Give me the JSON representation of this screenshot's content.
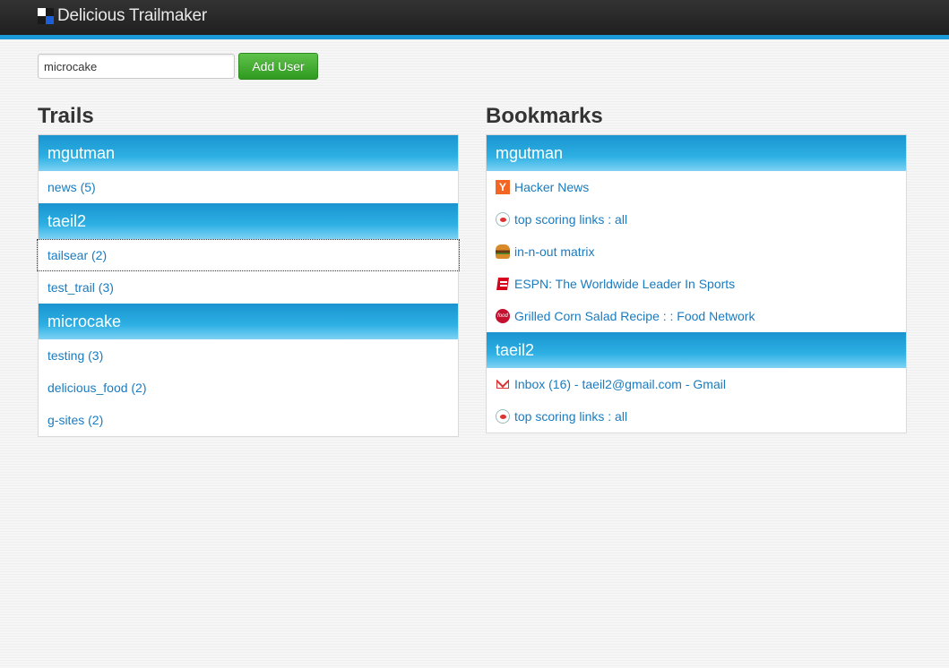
{
  "app": {
    "title": "Delicious Trailmaker"
  },
  "search": {
    "value": "microcake",
    "button_label": "Add User"
  },
  "trails": {
    "title": "Trails",
    "groups": [
      {
        "user": "mgutman",
        "items": [
          "news (5)"
        ]
      },
      {
        "user": "taeil2",
        "items": [
          "tailsear (2)",
          "test_trail (3)"
        ]
      },
      {
        "user": "microcake",
        "items": [
          "testing (3)",
          "delicious_food (2)",
          "g-sites (2)"
        ]
      }
    ]
  },
  "bookmarks": {
    "title": "Bookmarks",
    "groups": [
      {
        "user": "mgutman",
        "items": [
          {
            "label": "Hacker News",
            "icon": "hacker-news-icon"
          },
          {
            "label": "top scoring links : all",
            "icon": "reddit-icon"
          },
          {
            "label": "in-n-out matrix",
            "icon": "burger-icon"
          },
          {
            "label": "ESPN: The Worldwide Leader In Sports",
            "icon": "espn-icon"
          },
          {
            "label": "Grilled Corn Salad Recipe : : Food Network",
            "icon": "food-network-icon"
          }
        ]
      },
      {
        "user": "taeil2",
        "items": [
          {
            "label": "Inbox (16) - taeil2@gmail.com - Gmail",
            "icon": "gmail-icon"
          },
          {
            "label": "top scoring links : all",
            "icon": "reddit-icon"
          }
        ]
      }
    ]
  },
  "colors": {
    "accent": "#1a9ad7",
    "link": "#1a7bbf",
    "button": "#2f9a1f"
  }
}
